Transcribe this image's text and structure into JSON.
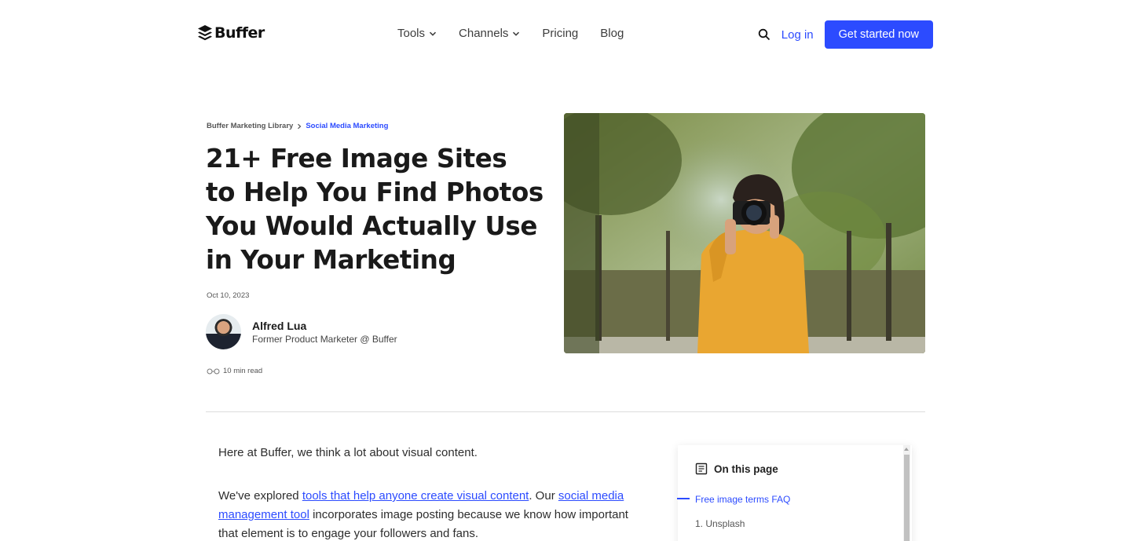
{
  "nav": {
    "logo_text": "Buffer",
    "menu": [
      {
        "label": "Tools",
        "has_dropdown": true
      },
      {
        "label": "Channels",
        "has_dropdown": true
      },
      {
        "label": "Pricing",
        "has_dropdown": false
      },
      {
        "label": "Blog",
        "has_dropdown": false
      }
    ],
    "login_label": "Log in",
    "cta_label": "Get started now",
    "search_icon": "search-icon"
  },
  "hero": {
    "breadcrumb": [
      "Buffer Marketing Library",
      "Social Media Marketing"
    ],
    "title": "21+ Free Image Sites to Help You Find Photos You Would Actually Use in Your Marketing",
    "date": "Oct 10, 2023",
    "author": {
      "name": "Alfred Lua",
      "role": "Former Product Marketer @ Buffer"
    },
    "read_time": "10 min read",
    "image_icon": "photographer-photo"
  },
  "article": {
    "p1": "Here at Buffer, we think a lot about visual content.",
    "p2": {
      "t1": "We've explored ",
      "link1": "tools that help anyone create visual content",
      "t2": ". Our ",
      "link2": "social media management tool",
      "t3": " incorporates image posting because we know how important that element is to engage your followers and fans."
    }
  },
  "toc": {
    "heading": "On this page",
    "items": [
      "Free image terms FAQ",
      "1. Unsplash"
    ]
  },
  "colors": {
    "accent": "#2c4bff",
    "text": "#1a1a1a"
  }
}
